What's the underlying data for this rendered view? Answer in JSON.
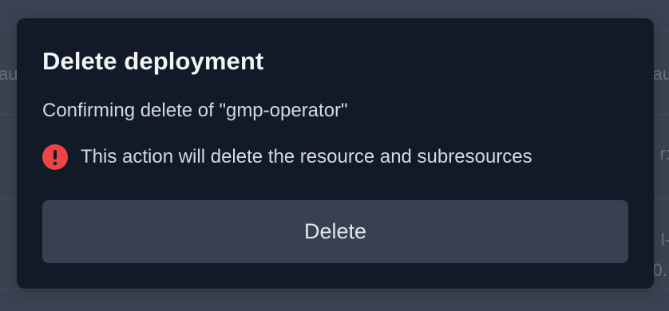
{
  "background": {
    "fragments_left": [
      "au"
    ],
    "fragments_right": [
      "au",
      "r:",
      "l-",
      "0.:"
    ]
  },
  "modal": {
    "title": "Delete deployment",
    "subtitle": "Confirming delete of \"gmp-operator\"",
    "warning": {
      "icon": "exclamation-circle-icon",
      "color": "#ef4444",
      "text": "This action will delete the resource and subresources"
    },
    "delete_button_label": "Delete"
  }
}
